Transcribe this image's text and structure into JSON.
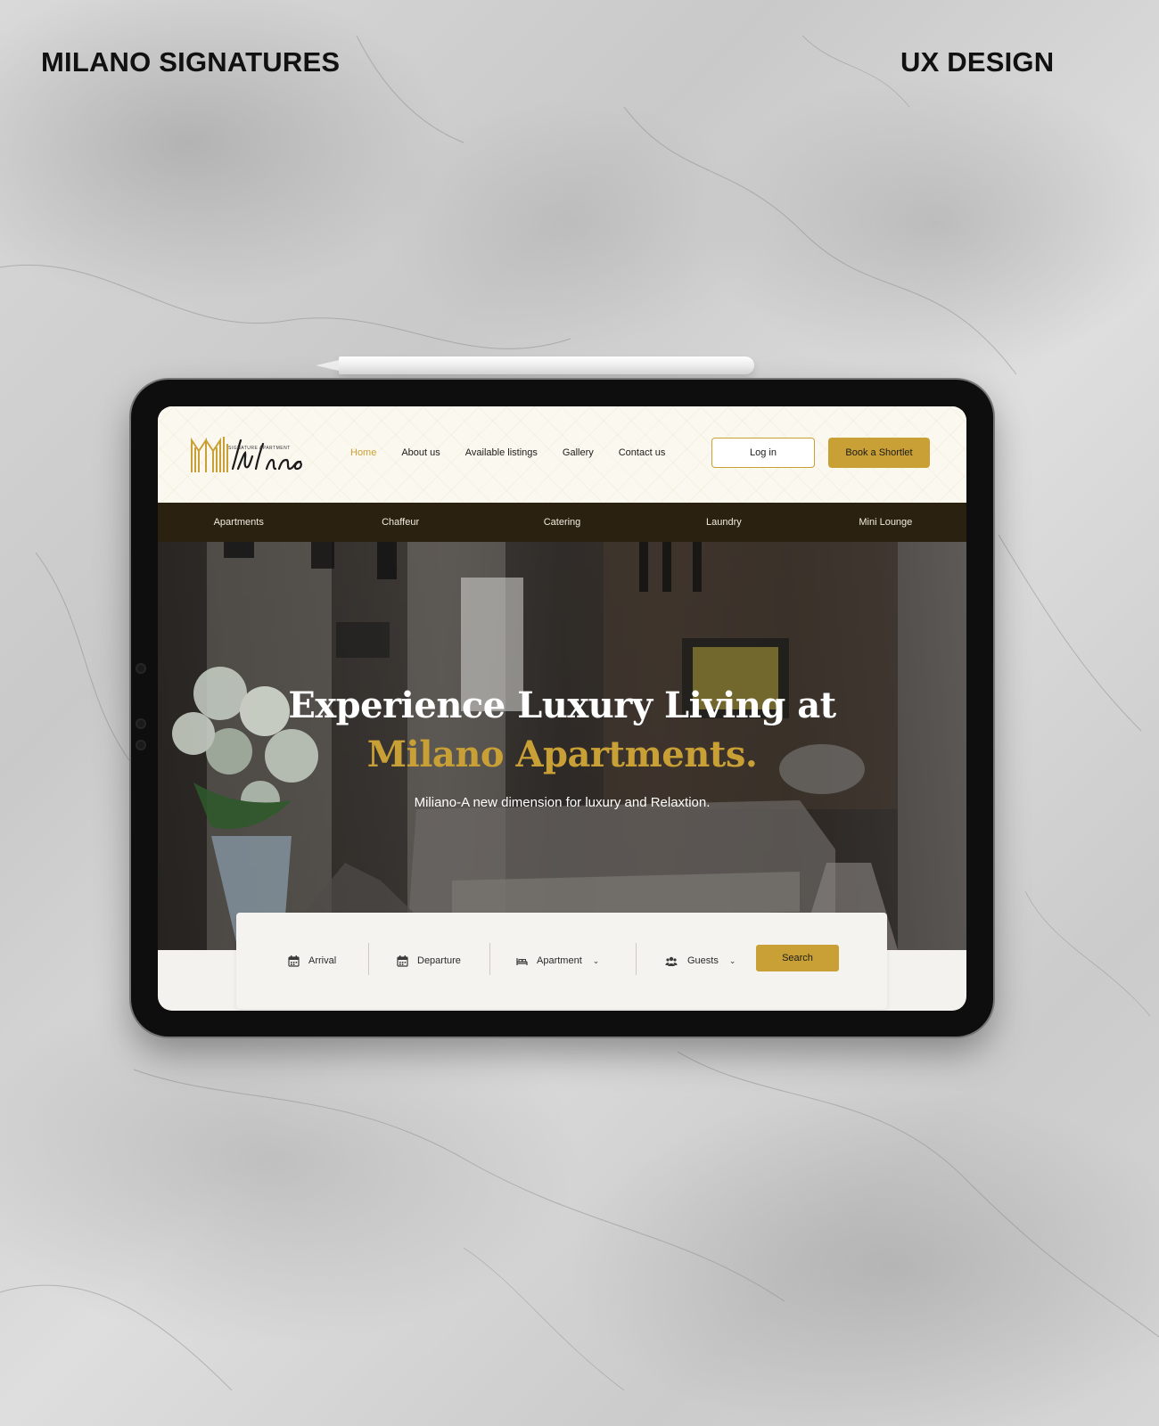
{
  "page": {
    "brand_label": "MILANO SIGNATURES",
    "section_label": "UX DESIGN"
  },
  "site": {
    "logo": {
      "wordmark": "Milano",
      "tagline": "SIGNATURE APARTMENT"
    },
    "nav": [
      {
        "label": "Home",
        "active": true
      },
      {
        "label": "About us",
        "active": false
      },
      {
        "label": "Available listings",
        "active": false
      },
      {
        "label": "Gallery",
        "active": false
      },
      {
        "label": "Contact us",
        "active": false
      }
    ],
    "login_label": "Log in",
    "book_label": "Book a Shortlet",
    "services": [
      "Apartments",
      "Chaffeur",
      "Catering",
      "Laundry",
      "Mini Lounge"
    ],
    "hero": {
      "title_line1": "Experience Luxury Living at",
      "title_line2": "Milano Apartments.",
      "subtitle": "Miliano-A new dimension for luxury and Relaxtion."
    },
    "search": {
      "arrival_label": "Arrival",
      "departure_label": "Departure",
      "apartment_label": "Apartment",
      "guests_label": "Guests",
      "search_label": "Search",
      "icons": {
        "arrival": "calendar-icon",
        "departure": "calendar-icon",
        "apartment": "bed-icon",
        "guests": "people-icon"
      }
    },
    "colors": {
      "gold": "#c9a035",
      "service_bar": "#2a2110",
      "header_bg": "#fbf8ef"
    }
  }
}
